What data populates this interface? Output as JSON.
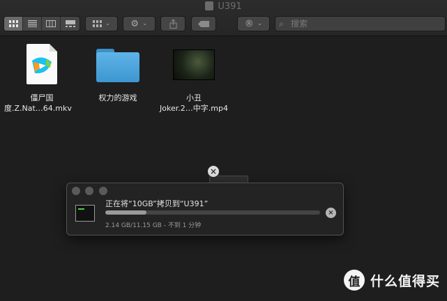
{
  "window": {
    "title": "U391"
  },
  "toolbar": {
    "view_modes": [
      "icon-view",
      "list-view",
      "column-view",
      "gallery-view"
    ],
    "group_icon": "group-icon",
    "action_icon": "gear-icon",
    "share_icon": "share-icon",
    "tag_icon": "tag-icon",
    "app_icon": "registered-icon",
    "search_placeholder": "搜索"
  },
  "files": [
    {
      "name_line1": "僵尸国",
      "name_line2": "度.Z.Nat…64.mkv",
      "kind": "video-app-document"
    },
    {
      "name_line1": "权力的游戏",
      "name_line2": "",
      "kind": "folder"
    },
    {
      "name_line1": "小丑",
      "name_line2": "Joker.2…中字.mp4",
      "kind": "video-thumbnail"
    }
  ],
  "copy_dialog": {
    "message": "正在将“10GB”拷贝到“U391”",
    "status": "2.14 GB/11.15 GB - 不到 1 分钟",
    "progress_fraction": 0.19
  },
  "watermark": {
    "logo_char": "值",
    "text": "什么值得买"
  },
  "colors": {
    "folder": "#4aa3dc",
    "background": "#1e1e1e",
    "dialog": "#232323"
  }
}
